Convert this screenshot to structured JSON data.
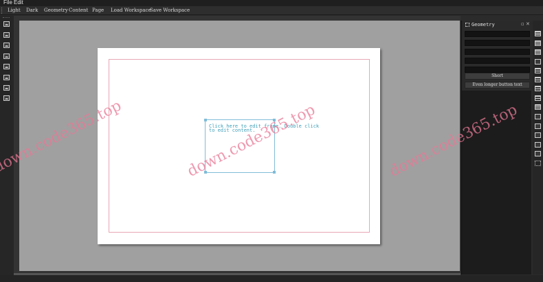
{
  "menu": {
    "file": "File",
    "edit": "Edit"
  },
  "toolbar": {
    "items": [
      "Light",
      "Dark",
      "Geometry",
      "Content",
      "Page",
      "Load Workspace",
      "Save Workspace"
    ]
  },
  "canvas": {
    "frame_hint": "Click here to edit frame. Double click\nto edit content."
  },
  "panel": {
    "title": "Geometry",
    "fields": [
      "",
      "",
      "",
      "",
      ""
    ],
    "buttons": {
      "short": "Short",
      "longer": "Even longer button text"
    }
  },
  "left_tools": [
    "image-icon",
    "image-icon",
    "image-icon",
    "image-icon",
    "image-icon",
    "image-icon",
    "image-icon",
    "image-icon"
  ],
  "watermark": "down.code365.top"
}
